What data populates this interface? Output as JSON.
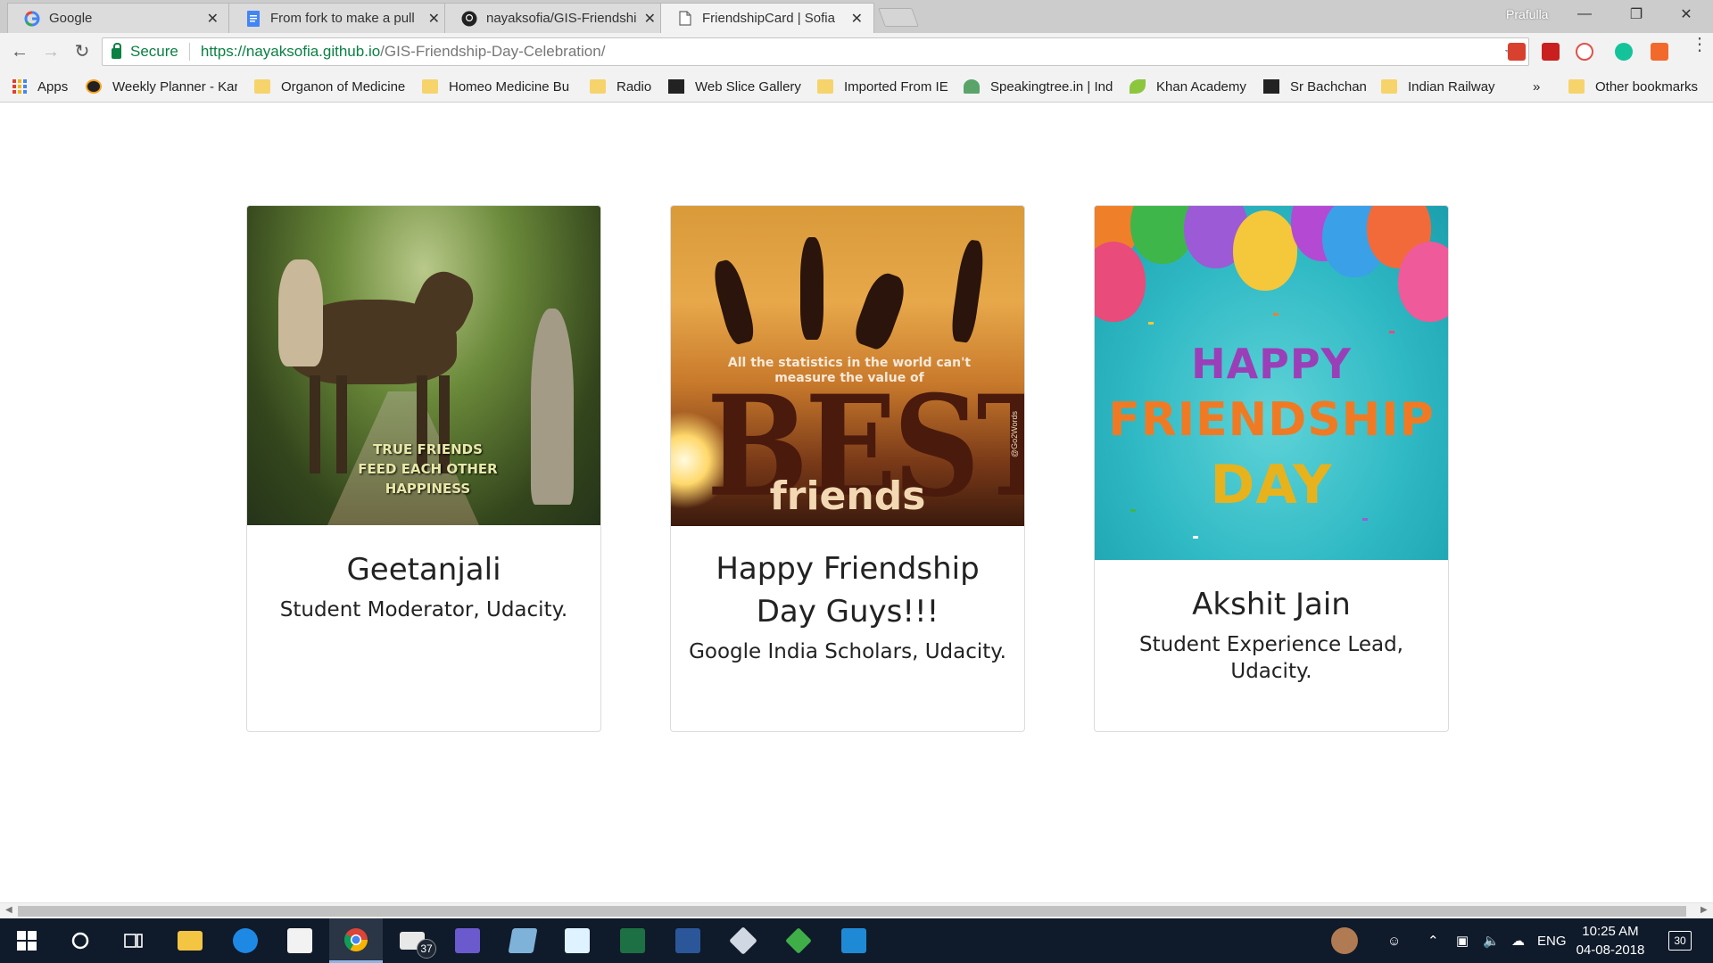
{
  "browser": {
    "tabs": [
      {
        "title": "Google",
        "icon": "google-icon",
        "active": false
      },
      {
        "title": "From fork to make a pull",
        "icon": "docs-icon",
        "active": false
      },
      {
        "title": "nayaksofia/GIS-Friendship",
        "icon": "github-icon",
        "active": false
      },
      {
        "title": "FriendshipCard | Sofia",
        "icon": "page-icon",
        "active": true
      }
    ],
    "tab_close": "✕",
    "profile": "Prafulla",
    "window_controls": {
      "minimize": "—",
      "restore": "❐",
      "close": "✕"
    },
    "secure_label": "Secure",
    "url_host": "https://nayaksofia.github.io",
    "url_path": "/GIS-Friendship-Day-Celebration/",
    "bookmarks": [
      {
        "label": "Apps",
        "icon": "apps-icon"
      },
      {
        "label": "Weekly Planner - Kar",
        "icon": "planner-icon"
      },
      {
        "label": "Organon of Medicine",
        "icon": "folder-icon"
      },
      {
        "label": "Homeo Medicine Bu",
        "icon": "folder-icon"
      },
      {
        "label": "Radio",
        "icon": "folder-icon"
      },
      {
        "label": "Web Slice Gallery",
        "icon": "web-slice-icon"
      },
      {
        "label": "Imported From IE",
        "icon": "folder-icon"
      },
      {
        "label": "Speakingtree.in | Ind",
        "icon": "tree-icon"
      },
      {
        "label": "Khan Academy",
        "icon": "leaf-icon"
      },
      {
        "label": "Sr Bachchan",
        "icon": "bachchan-icon"
      },
      {
        "label": "Indian Railway",
        "icon": "folder-icon"
      }
    ],
    "bookmarks_overflow": "»",
    "other_bookmarks": "Other bookmarks"
  },
  "cards": [
    {
      "name": "Geetanjali",
      "role": "Student Moderator, Udacity.",
      "image_text": "TRUE FRIENDS\nFEED EACH OTHER\nHAPPINESS"
    },
    {
      "name": "Happy Friendship Day Guys!!!",
      "role": "Google India Scholars, Udacity.",
      "image_text_small": "All the statistics in the world can't measure the value of",
      "image_text_big": "BEST",
      "image_text_friends": "friends",
      "image_credit": "@Go2Words"
    },
    {
      "name": "Akshit Jain",
      "role": "Student Experience Lead, Udacity.",
      "image_text_1": "HAPPY",
      "image_text_2": "FRIENDSHIP",
      "image_text_3": "DAY"
    }
  ],
  "taskbar": {
    "mail_badge": "37",
    "language": "ENG",
    "time": "10:25 AM",
    "date": "04-08-2018",
    "notifications": "30"
  },
  "colors": {
    "secure_green": "#0b8043",
    "taskbar_bg": "#0f1a2a",
    "page_bg": "#ffffff",
    "card_border": "#dcdcdc"
  }
}
